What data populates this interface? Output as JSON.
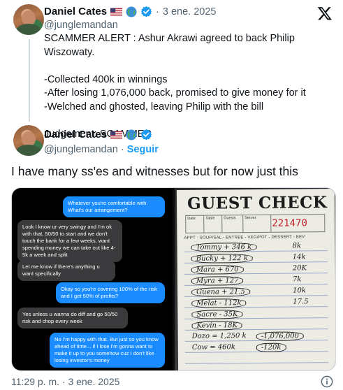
{
  "quoted_tweet": {
    "author_name": "Daniel Cates",
    "dot": "·",
    "date": "3 ene. 2025",
    "lines": [
      "SCAMMER ALERT : Ashur Akrawi agreed to back Philip Wiszowaty.",
      "",
      "-Collected 400k in winnings",
      "-After losing 1,076,000 back, promised to give money for it",
      "-Welched and ghosted, leaving Philip with the bill",
      "",
      "Judgement: SCAMMER"
    ]
  },
  "main_tweet": {
    "author_name": "Daniel Cates",
    "handle": "@junglemandan",
    "dot": "·",
    "follow_label": "Seguir",
    "text": "I have many ss'es and witnesses but for now just this",
    "timestamp": "11:29 p. m. · 3 ene. 2025"
  },
  "quoted_handle": "@junglemandan",
  "chat_messages": [
    {
      "dir": "out",
      "text": "Whatever you're comfortable with. What's our arrangement?"
    },
    {
      "dir": "in",
      "text": "Look I know ur very swingy and I'm ok with that, 50/50 to start and we don't touch the bank for a few weeks, want spending money we can take out like 4-5k a week and split"
    },
    {
      "dir": "in",
      "text": "Let me know if there's anything u want specifically"
    },
    {
      "dir": "out",
      "text": "Okay so you're covering 100% of the risk and I get 50% of profits?"
    },
    {
      "dir": "in",
      "text": "Yes unless u wanna do diff and go 50/50 risk and chop every week"
    },
    {
      "dir": "out",
      "text": "No I'm happy with that. But just so you know ahead of time... if I lose I'm gonna want to make it up to you somehow cuz I don't like losing investor's money"
    }
  ],
  "guest_check": {
    "title": "GUEST CHECK",
    "headers": [
      "Date",
      "Table",
      "Guests",
      "Server"
    ],
    "number": "221470",
    "columns": "APPT - SOUP/SAL - ENTREE - VEG/POT - DESSERT - BEV",
    "entries": [
      {
        "left": "Tommy + 346 k",
        "right": "8k"
      },
      {
        "left": "Bucky + 122 k",
        "right": "14k"
      },
      {
        "left": "Mara + 670",
        "right": "20K"
      },
      {
        "left": "Myra + 127",
        "right": "7k"
      },
      {
        "left": "Guena + 21.5",
        "right": "10k"
      },
      {
        "left": "Melat - 112k",
        "right": "17.5"
      },
      {
        "left": "Sacre - 35K",
        "right": ""
      },
      {
        "left": "Kevin - 18K",
        "right": ""
      },
      {
        "left": "Dozo = 1,250 k",
        "right": "-1,076,000"
      },
      {
        "left": "Cow = 460k",
        "right": "-120k"
      }
    ]
  }
}
